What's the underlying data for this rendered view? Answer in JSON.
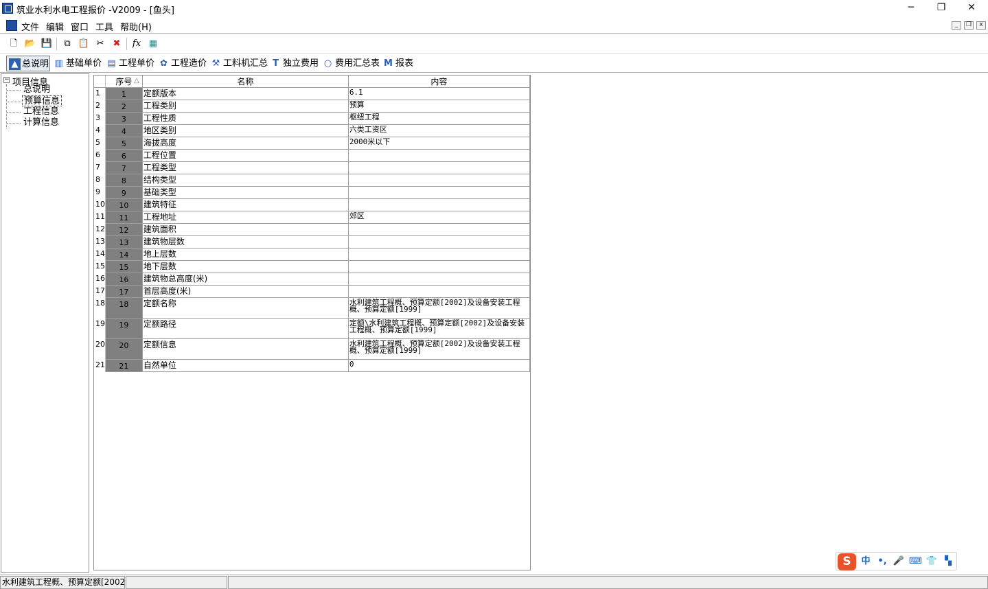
{
  "window": {
    "title": "筑业水利水电工程报价 -V2009 - [鱼头]",
    "controls": {
      "minimize": "─",
      "restore": "❐",
      "close": "✕"
    }
  },
  "menu": {
    "items": [
      {
        "label": "文件"
      },
      {
        "label": "编辑"
      },
      {
        "label": "窗口"
      },
      {
        "label": "工具"
      },
      {
        "label": "帮助(H)"
      }
    ],
    "mdi_controls": {
      "minimize": "_",
      "restore": "❐",
      "close": "x"
    }
  },
  "toolbar": {
    "icons": [
      {
        "name": "new-file-icon",
        "glyph": "🗋"
      },
      {
        "name": "open-folder-icon",
        "glyph": "📂"
      },
      {
        "name": "save-icon",
        "glyph": "💾"
      },
      {
        "name": "copy-icon",
        "glyph": "⧉"
      },
      {
        "name": "paste-icon",
        "glyph": "📋"
      },
      {
        "name": "cut-icon",
        "glyph": "✂"
      },
      {
        "name": "delete-icon",
        "glyph": "✖"
      },
      {
        "name": "function-icon",
        "glyph": "fx"
      },
      {
        "name": "calculator-icon",
        "glyph": "▦"
      }
    ]
  },
  "tabs": [
    {
      "label": "总说明",
      "icon": "▲",
      "active": true
    },
    {
      "label": "基础单价",
      "icon": "▥"
    },
    {
      "label": "工程单价",
      "icon": "▤"
    },
    {
      "label": "工程造价",
      "icon": "✿"
    },
    {
      "label": "工料机汇总",
      "icon": "⚒"
    },
    {
      "label": "独立费用",
      "icon": "T"
    },
    {
      "label": "费用汇总表",
      "icon": "○"
    },
    {
      "label": "报表",
      "icon": "M"
    }
  ],
  "tree": {
    "root": {
      "label": "项目信息",
      "expander": "−"
    },
    "items": [
      {
        "label": "总说明"
      },
      {
        "label": "预算信息",
        "selected": true
      },
      {
        "label": "工程信息"
      },
      {
        "label": "计算信息"
      }
    ]
  },
  "grid": {
    "headers": {
      "seq": "序号",
      "name": "名称",
      "content": "内容",
      "sort_indicator": "△"
    },
    "rows": [
      {
        "row": "1",
        "seq": "1",
        "name": "定额版本",
        "content": "6.1"
      },
      {
        "row": "2",
        "seq": "2",
        "name": "工程类别",
        "content": "预算"
      },
      {
        "row": "3",
        "seq": "3",
        "name": "工程性质",
        "content": "枢纽工程"
      },
      {
        "row": "4",
        "seq": "4",
        "name": "地区类别",
        "content": "六类工资区"
      },
      {
        "row": "5",
        "seq": "5",
        "name": "海拔高度",
        "content": "2000米以下"
      },
      {
        "row": "6",
        "seq": "6",
        "name": "工程位置",
        "content": ""
      },
      {
        "row": "7",
        "seq": "7",
        "name": "工程类型",
        "content": ""
      },
      {
        "row": "8",
        "seq": "8",
        "name": "结构类型",
        "content": ""
      },
      {
        "row": "9",
        "seq": "9",
        "name": "基础类型",
        "content": ""
      },
      {
        "row": "10",
        "seq": "10",
        "name": "建筑特征",
        "content": ""
      },
      {
        "row": "11",
        "seq": "11",
        "name": "工程地址",
        "content": "郊区"
      },
      {
        "row": "12",
        "seq": "12",
        "name": "建筑面积",
        "content": ""
      },
      {
        "row": "13",
        "seq": "13",
        "name": "建筑物层数",
        "content": ""
      },
      {
        "row": "14",
        "seq": "14",
        "name": "地上层数",
        "content": ""
      },
      {
        "row": "15",
        "seq": "15",
        "name": "地下层数",
        "content": ""
      },
      {
        "row": "16",
        "seq": "16",
        "name": "建筑物总高度(米)",
        "content": ""
      },
      {
        "row": "17",
        "seq": "17",
        "name": "首层高度(米)",
        "content": ""
      },
      {
        "row": "18",
        "seq": "18",
        "name": "定额名称",
        "content": "水利建筑工程概、预算定额[2002]及设备安装工程概、预算定额[1999]",
        "tall": true
      },
      {
        "row": "19",
        "seq": "19",
        "name": "定额路径",
        "content": "定额\\水利建筑工程概、预算定额[2002]及设备安装工程概、预算定额[1999]",
        "tall": true
      },
      {
        "row": "20",
        "seq": "20",
        "name": "定额信息",
        "content": "水利建筑工程概、预算定额[2002]及设备安装工程概、预算定额[1999]",
        "tall": true
      },
      {
        "row": "21",
        "seq": "21",
        "name": "自然单位",
        "content": "0"
      }
    ]
  },
  "status": {
    "pane1": "水利建筑工程概、预算定额[2002",
    "pane2": "",
    "pane3": ""
  },
  "ime": {
    "logo": "S",
    "mode": "中",
    "punct": "•,",
    "icons": [
      "microphone-icon",
      "keyboard-icon",
      "skin-icon",
      "toolbox-icon"
    ],
    "glyphs": [
      "🎤",
      "⌨",
      "👕",
      "▚"
    ]
  }
}
